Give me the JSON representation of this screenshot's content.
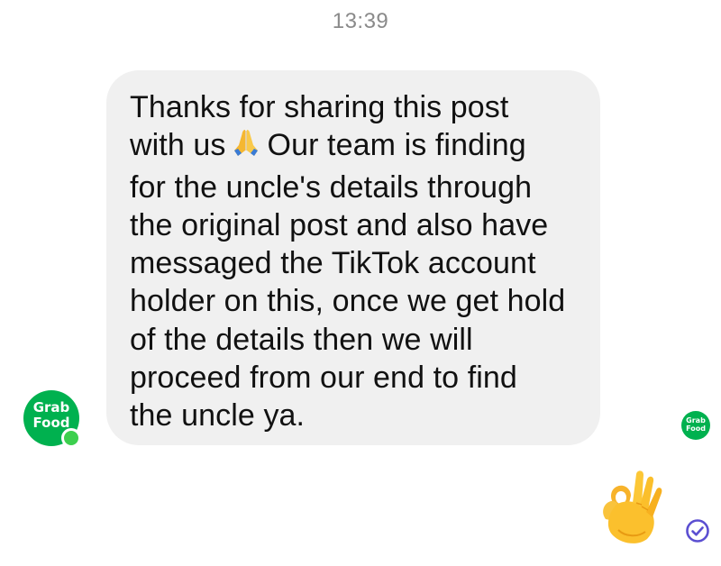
{
  "chat": {
    "timestamp": "13:39",
    "message": {
      "lines": [
        "Thanks for sharing this post",
        "with us",
        "Our team is finding",
        "for the uncle's details through",
        "the original post and also have",
        "messaged the TikTok account",
        "holder on this, once we get hold",
        "of the details then we will",
        "proceed from our end to find",
        "the uncle ya."
      ],
      "emoji": "folded-hands-icon"
    },
    "sender": {
      "avatar_text_line1": "Grab",
      "avatar_text_line2": "Food",
      "online": true,
      "brand_color": "#00b14f"
    },
    "reaction": {
      "emoji": "ok-hand-icon"
    },
    "read_receipt": {
      "avatar_text_line1": "Grab",
      "avatar_text_line2": "Food"
    },
    "status": {
      "icon": "check-circle-icon",
      "color": "#5b4fd1"
    },
    "colors": {
      "bubble": "#f0f0f0",
      "text": "#111111",
      "timestamp": "#8a8a8a"
    }
  }
}
